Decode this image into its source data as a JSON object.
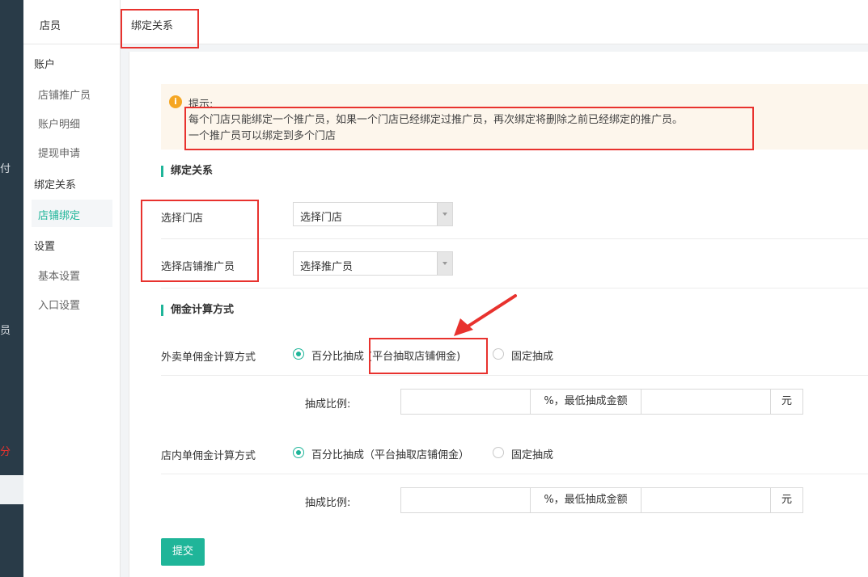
{
  "rail": {
    "fragments": [
      "付",
      "员",
      "分"
    ],
    "accent_color": "#e8322e",
    "bg_color": "#293b48"
  },
  "sidebar": {
    "header": "店员",
    "groups": [
      {
        "title": "账户",
        "items": [
          "店铺推广员",
          "账户明细",
          "提现申请"
        ]
      },
      {
        "title": "绑定关系",
        "items": [
          "店铺绑定"
        ]
      },
      {
        "title": "设置",
        "items": [
          "基本设置",
          "入口设置"
        ]
      }
    ],
    "active_item": "店铺绑定",
    "accent_color": "#1fb599"
  },
  "tabs": {
    "active": "绑定关系"
  },
  "notice": {
    "title": "提示:",
    "lines": [
      "每个门店只能绑定一个推广员，如果一个门店已经绑定过推广员，再次绑定将删除之前已经绑定的推广员。",
      "一个推广员可以绑定到多个门店"
    ],
    "icon": "info-icon"
  },
  "binding": {
    "section_title": "绑定关系",
    "store_label": "选择门店",
    "store_select_value": "选择门店",
    "promoter_label": "选择店铺推广员",
    "promoter_select_value": "选择推广员"
  },
  "commission": {
    "section_title": "佣金计算方式",
    "takeout": {
      "label": "外卖单佣金计算方式",
      "option_percent": "百分比抽成",
      "option_percent_note": "(平台抽取店铺佣金)",
      "option_fixed": "固定抽成",
      "selected": "percent",
      "ratio_label": "抽成比例:",
      "ratio_value": "",
      "min_amount_addon": "%，最低抽成金额",
      "min_amount_value": "",
      "unit": "元"
    },
    "instore": {
      "label": "店内单佣金计算方式",
      "option_percent": "百分比抽成（平台抽取店铺佣金）",
      "option_fixed": "固定抽成",
      "selected": "percent",
      "ratio_label": "抽成比例:",
      "ratio_value": "",
      "min_amount_addon": "%，最低抽成金额",
      "min_amount_value": "",
      "unit": "元"
    }
  },
  "submit_label": "提交",
  "annotation_color": "#e8322e"
}
